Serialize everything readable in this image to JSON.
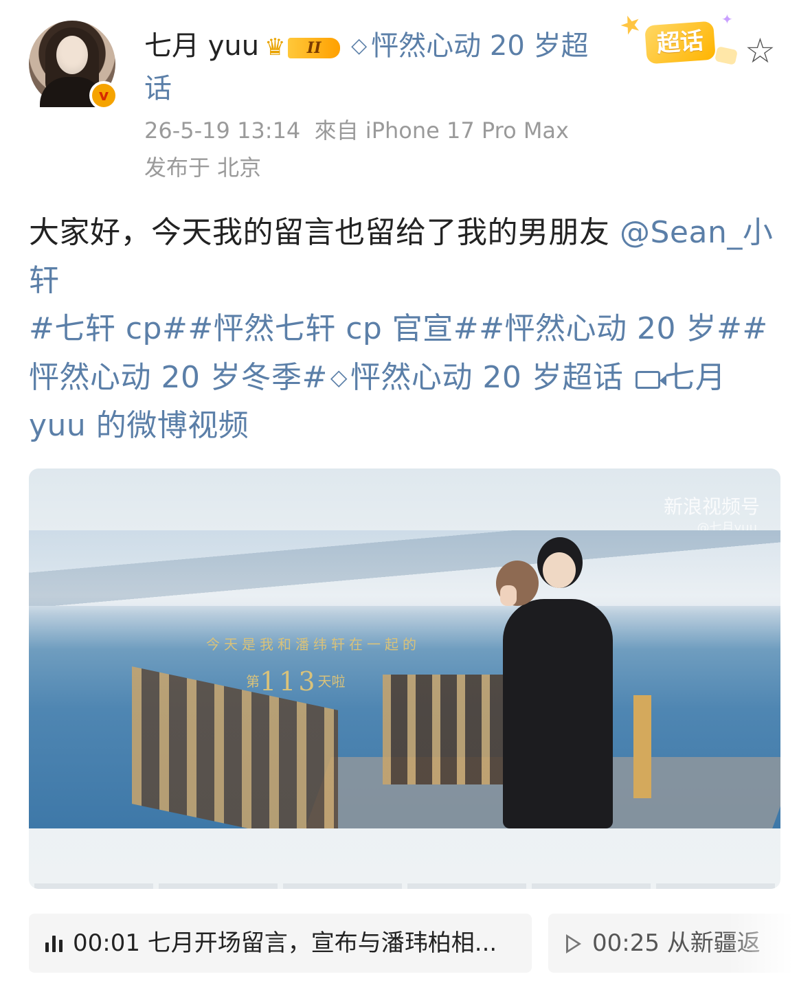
{
  "author": {
    "name": "七月 yuu",
    "level_badge": "II",
    "verified_mark": "v"
  },
  "supertopic": {
    "header_link": "怦然心动 20 岁超",
    "header_link_wrap": "话",
    "badge_label": "超话"
  },
  "meta": {
    "time": "26-5-19 13:14",
    "source": "來自 iPhone 17 Pro Max",
    "location": "发布于 北京"
  },
  "post": {
    "text": "大家好，今天我的留言也留给了我的男朋友",
    "mention": "@Sean_小轩",
    "hashtag1": "#七轩 cp#",
    "hashtag2": "#怦然七轩 cp 官宣#",
    "hashtag3": "#怦然心动 20 岁#",
    "hashtag4": "#怦然心动 20 岁冬季#",
    "supertopic_link": "怦然心动 20 岁超话",
    "video_link": "七月 yuu 的微博视频"
  },
  "video": {
    "caption_line1": "今天是我和潘纬轩在一起的",
    "caption_line2_prefix": "第",
    "caption_line2_number": "113",
    "caption_line2_suffix": "天啦",
    "watermark": "新浪视频号",
    "watermark_sub": "@七月yuu"
  },
  "chapters": [
    {
      "time": "00:01",
      "title": "七月开场留言，宣布与潘玮柏相..."
    },
    {
      "time": "00:25",
      "title": "从新疆返"
    }
  ],
  "colors": {
    "link": "#5b7fa8",
    "meta": "#9a9a9a",
    "badge_gold": "#ffb400"
  },
  "icons": [
    "verified-icon",
    "crown-icon",
    "diamond-icon",
    "star-icon",
    "video-icon",
    "audio-bars-icon",
    "play-icon"
  ]
}
